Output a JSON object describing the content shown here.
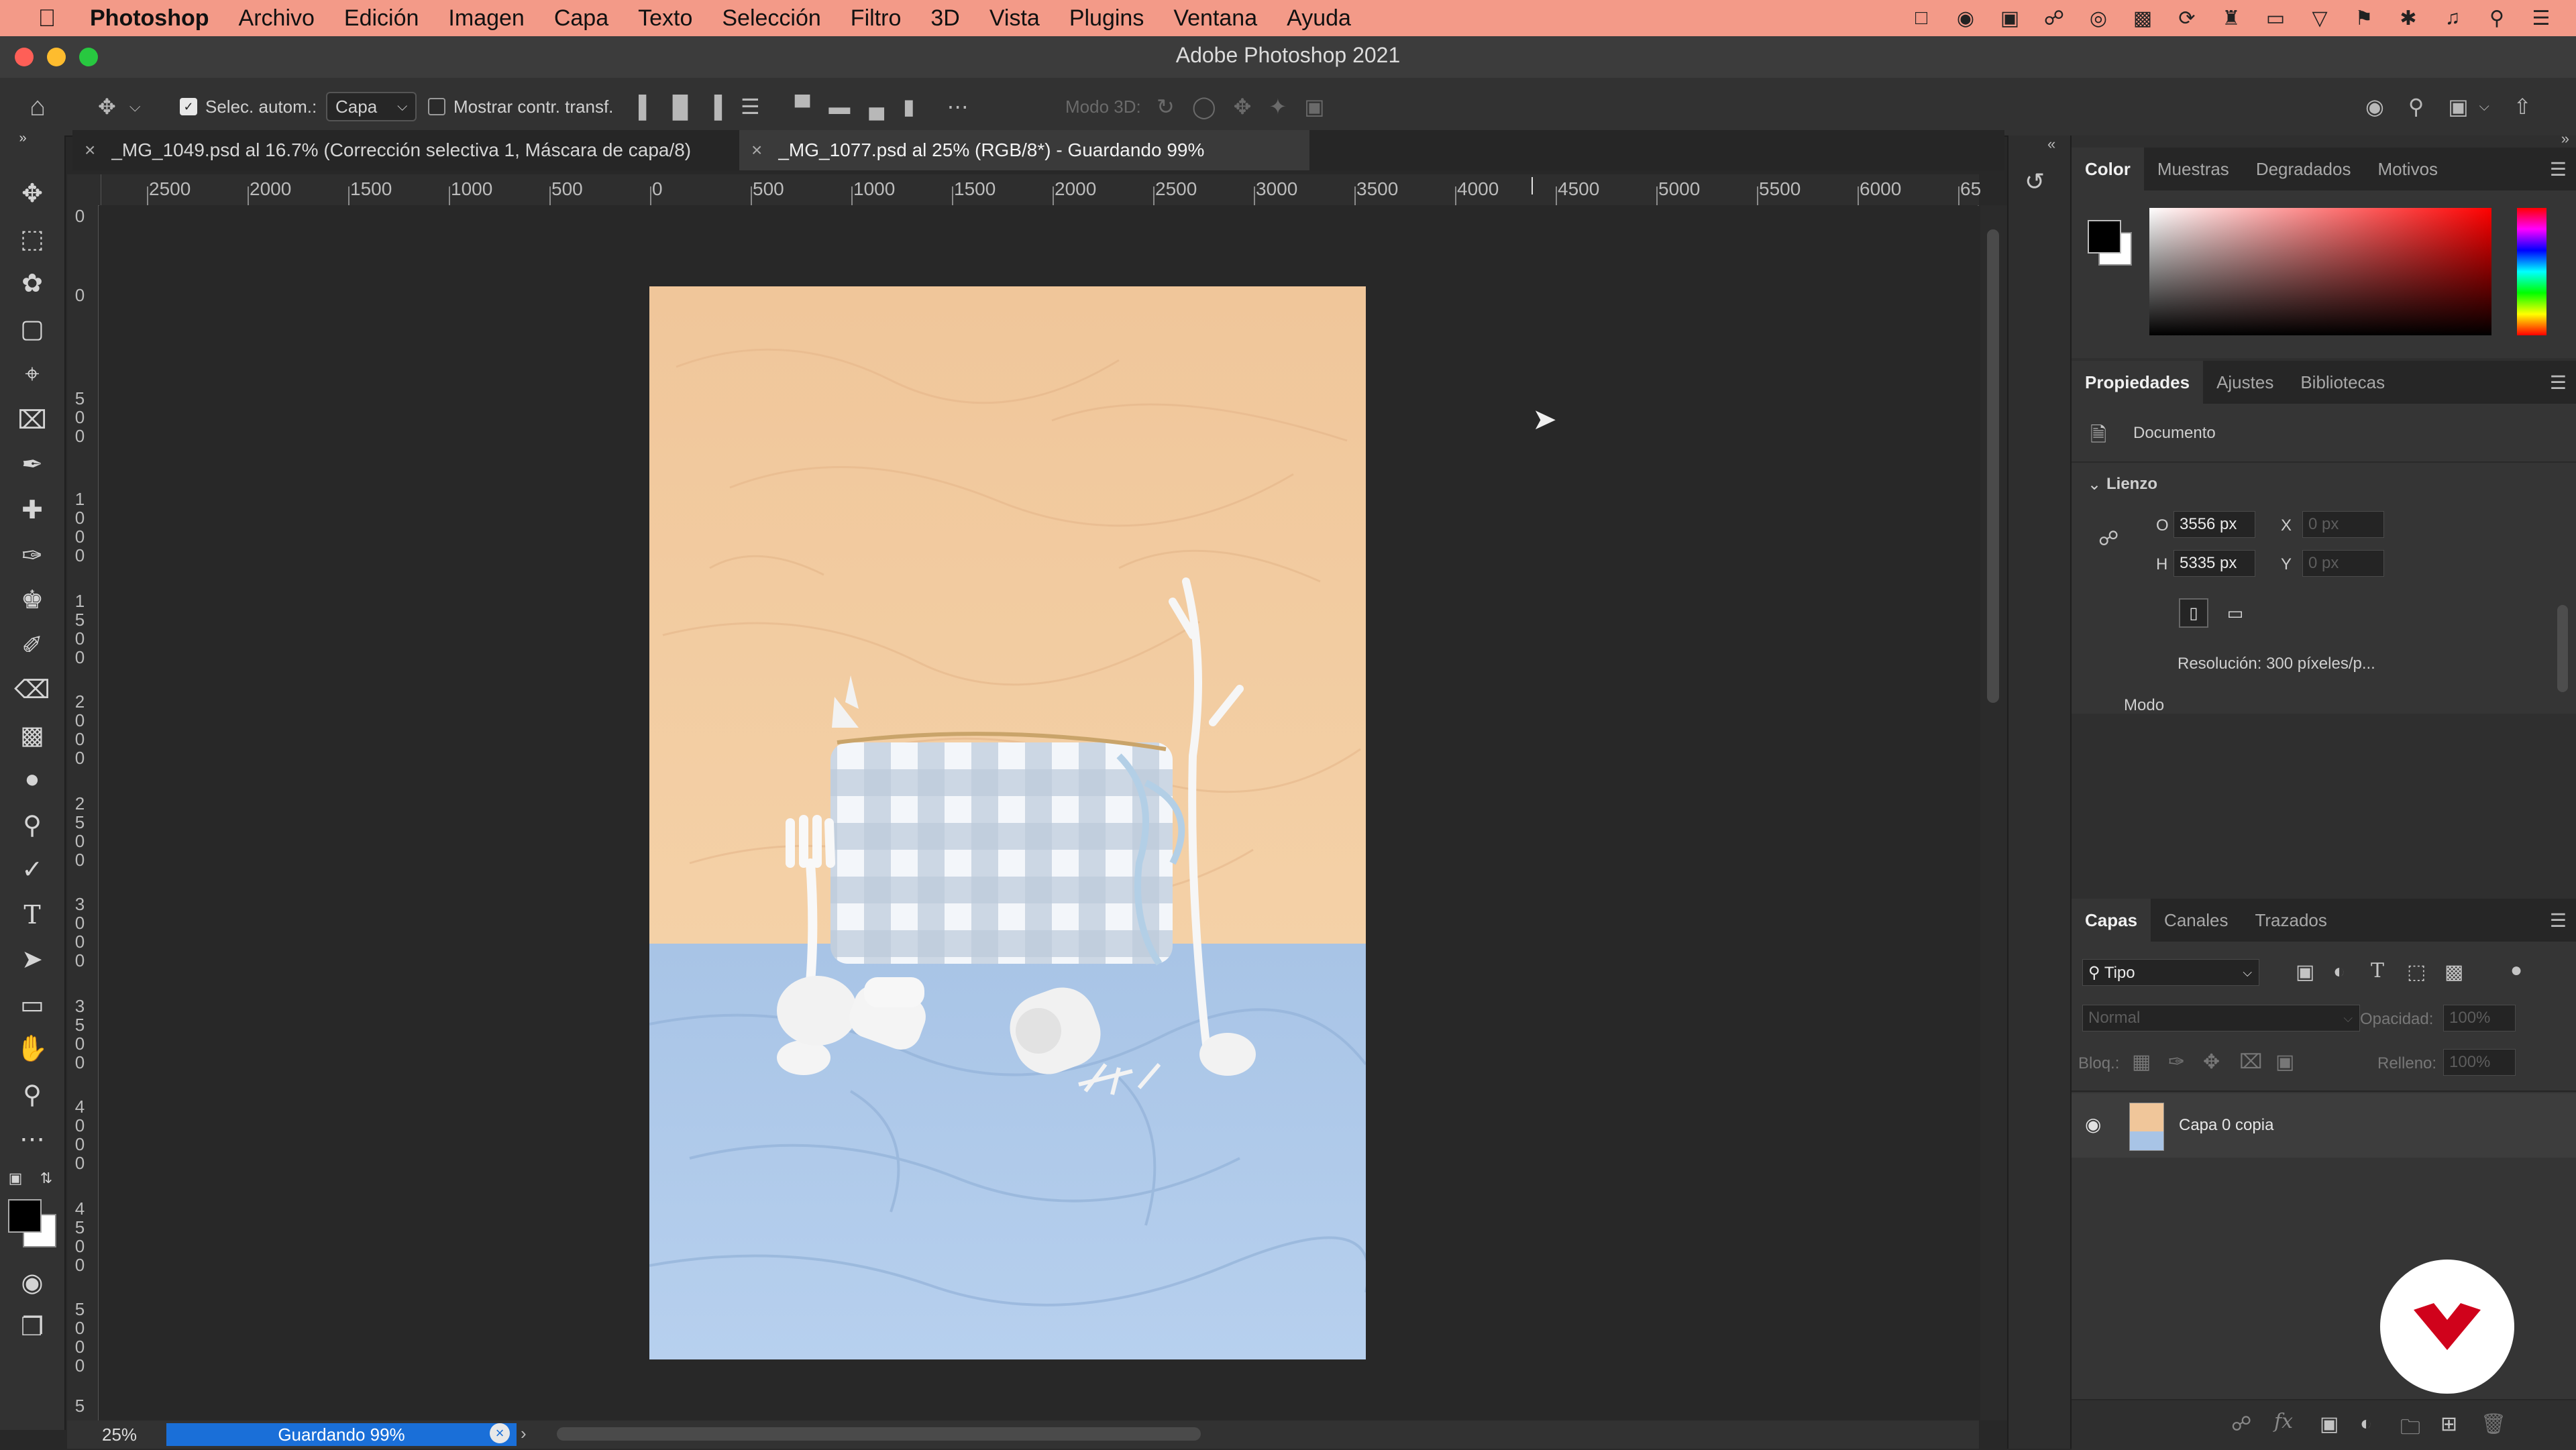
{
  "menubar": {
    "app_name": "Photoshop",
    "items": [
      "Archivo",
      "Edición",
      "Imagen",
      "Capa",
      "Texto",
      "Selección",
      "Filtro",
      "3D",
      "Vista",
      "Plugins",
      "Ventana",
      "Ayuda"
    ]
  },
  "window": {
    "title": "Adobe Photoshop 2021"
  },
  "options_bar": {
    "auto_select_label": "Selec. autom.:",
    "auto_select_target": "Capa",
    "show_transform_label": "Mostrar contr. transf.",
    "mode_3d_label": "Modo 3D:"
  },
  "tabs": [
    {
      "label": "_MG_1049.psd al 16.7% (Corrección selectiva 1, Máscara de capa/8)"
    },
    {
      "label": "_MG_1077.psd al 25% (RGB/8*) - Guardando 99%"
    }
  ],
  "ruler": {
    "h_labels": [
      "2500",
      "2000",
      "1500",
      "1000",
      "500",
      "0",
      "500",
      "1000",
      "1500",
      "2000",
      "2500",
      "3000",
      "3500",
      "4000",
      "4500",
      "5000",
      "5500",
      "6000",
      "65"
    ],
    "v_labels": [
      "0",
      "0",
      "5 0 0",
      "1 0 0 0",
      "1 5 0 0",
      "2 0 0 0",
      "2 5 0 0",
      "3 0 0 0",
      "3 5 0 0",
      "4 0 0 0",
      "4 5 0 0",
      "5 0 0 0",
      "5"
    ]
  },
  "status": {
    "zoom": "25%",
    "progress_label": "Guardando 99%",
    "progress_fraction": 0.99
  },
  "color_panel": {
    "tabs": [
      "Color",
      "Muestras",
      "Degradados",
      "Motivos"
    ],
    "foreground": "#000000",
    "background": "#ffffff",
    "hue_color": "#ff0000"
  },
  "properties_panel": {
    "tabs": [
      "Propiedades",
      "Ajustes",
      "Bibliotecas"
    ],
    "doc_label": "Documento",
    "section_label": "Lienzo",
    "width_label": "O",
    "width_value": "3556 px",
    "height_label": "H",
    "height_value": "5335 px",
    "x_label": "X",
    "x_placeholder": "0 px",
    "y_label": "Y",
    "y_placeholder": "0 px",
    "resolution": "Resolución: 300 píxeles/p...",
    "mode_label": "Modo"
  },
  "layers_panel": {
    "tabs": [
      "Capas",
      "Canales",
      "Trazados"
    ],
    "filter_label": "Tipo",
    "blend_mode": "Normal",
    "opacity_label": "Opacidad:",
    "opacity_value": "100%",
    "lock_label": "Bloq.:",
    "fill_label": "Relleno:",
    "fill_value": "100%",
    "layers": [
      {
        "name": "Capa 0 copia"
      }
    ]
  },
  "colors": {
    "menubar": "#f39a88",
    "accent": "#1a6fd8",
    "wall": "#f2cc9f",
    "table": "#aac7ea",
    "logo": "#d0021b"
  }
}
